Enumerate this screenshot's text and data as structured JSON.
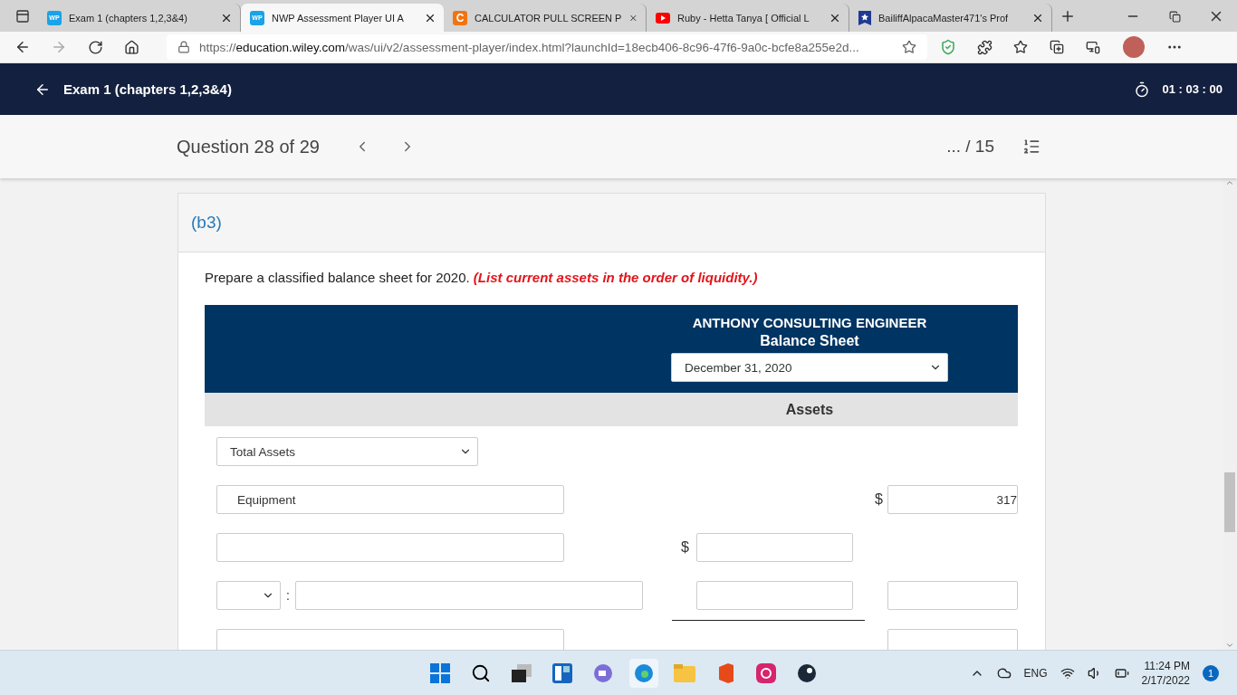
{
  "browser": {
    "tabs": [
      {
        "title": "Exam 1 (chapters 1,2,3&4)",
        "selected": false,
        "favicon": {
          "kind": "letters",
          "text": "WP"
        }
      },
      {
        "title": "NWP Assessment Player UI A",
        "selected": true,
        "favicon": {
          "kind": "letters",
          "text": "WP"
        }
      },
      {
        "title": "CALCULATOR PULL SCREEN P",
        "selected": false,
        "favicon": {
          "kind": "letter",
          "text": "C"
        }
      },
      {
        "title": "Ruby - Hetta Tanya [ Official L",
        "selected": false,
        "favicon": {
          "kind": "play"
        }
      },
      {
        "title": "BailiffAlpacaMaster471's Prof",
        "selected": false,
        "favicon": {
          "kind": "star"
        }
      }
    ],
    "url": {
      "scheme": "https://",
      "host": "education.wiley.com",
      "path": "/was/ui/v2/assessment-player/index.html?launchId=18ecb406-8c96-47f6-9a0c-bcfe8a255e2d..."
    }
  },
  "exam": {
    "title": "Exam 1 (chapters 1,2,3&4)",
    "timer": "01 : 03 : 00"
  },
  "question_bar": {
    "question": "Question 28 of 29",
    "score": "... / 15"
  },
  "part": {
    "label": "(b3)",
    "instruction": "Prepare a classified balance sheet for 2020.",
    "note": "(List current assets in the order of liquidity.)"
  },
  "balance_sheet": {
    "company": "ANTHONY CONSULTING ENGINEER",
    "title": "Balance Sheet",
    "date": "December 31, 2020",
    "section": "Assets",
    "rows": [
      {
        "kind": "heading",
        "value": "Total Assets"
      },
      {
        "kind": "account",
        "account": "Equipment",
        "right": {
          "currency": "$",
          "amount": "317"
        }
      },
      {
        "kind": "account",
        "middle": {
          "currency": "$",
          "underline": false
        }
      },
      {
        "kind": "prefixed",
        "separator": ":",
        "middle": {
          "underline": true
        },
        "right": {}
      },
      {
        "kind": "account",
        "right": {}
      }
    ]
  },
  "taskbar": {
    "language": "ENG",
    "time": "11:24 PM",
    "date": "2/17/2022",
    "notifications": "1"
  }
}
